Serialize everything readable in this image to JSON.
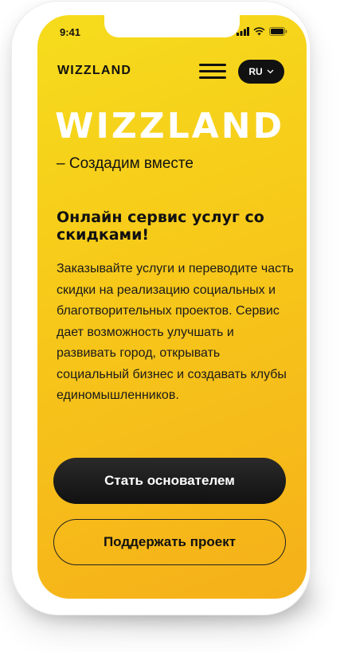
{
  "status_bar": {
    "time": "9:41",
    "icons": [
      "signal-icon",
      "wifi-icon",
      "battery-icon"
    ]
  },
  "header": {
    "logo": "WIZZLAND",
    "menu_icon": "hamburger-menu-icon",
    "language": "RU",
    "language_icon": "chevron-down-icon"
  },
  "hero": {
    "title": "WIZZLAND",
    "tagline": "– Создадим вместе"
  },
  "content": {
    "headline": "Онлайн сервис услуг со скидками!",
    "description": "Заказывайте услуги и переводите часть скидки на реализацию социальных и благотворительных проектов.  Сервис дает возможность улучшать и развивать город, открывать социальный бизнес и создавать клубы единомышленников."
  },
  "actions": {
    "primary_label": "Стать основателем",
    "secondary_label": "Поддержать проект"
  },
  "colors": {
    "accent_yellow": "#f7c81a",
    "dark": "#111111",
    "white": "#ffffff"
  }
}
